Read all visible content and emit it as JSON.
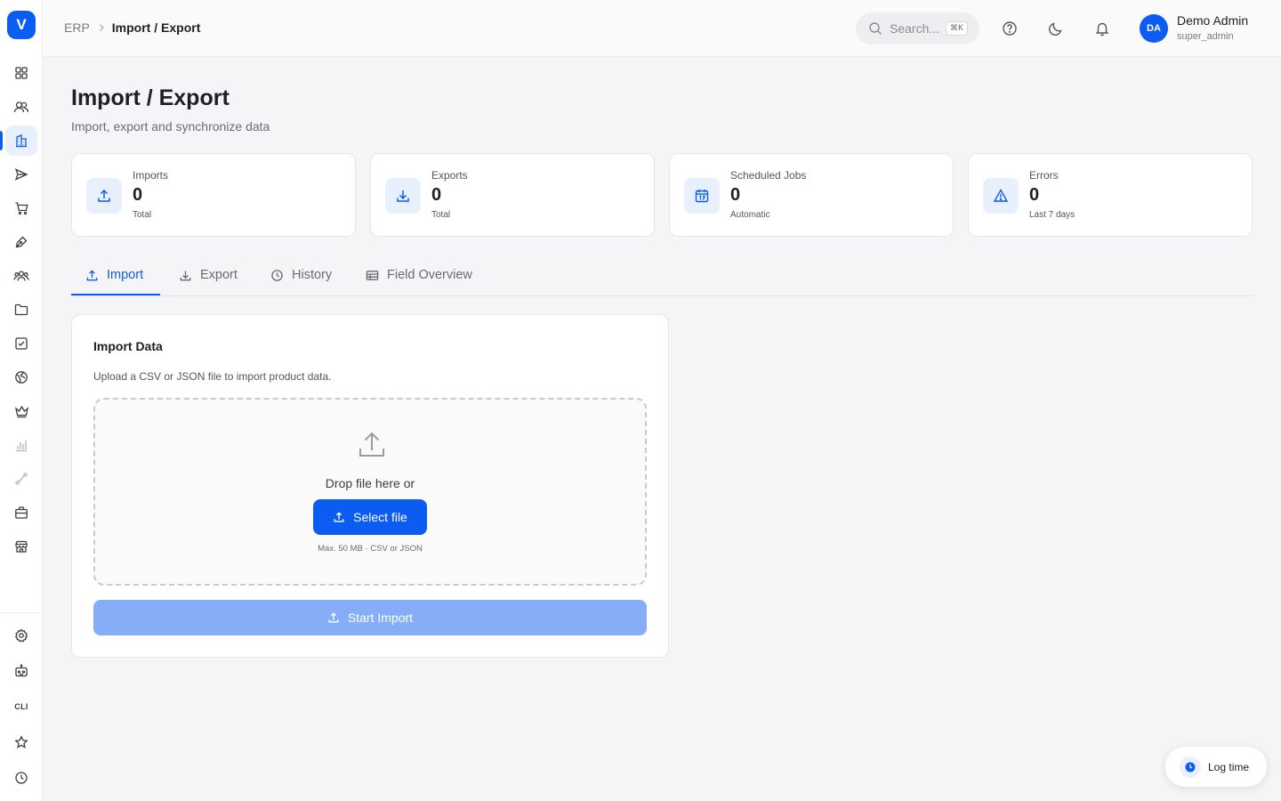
{
  "app": {
    "logo_letter": "V"
  },
  "sidebar": {
    "items": [
      {
        "name": "dashboard-icon"
      },
      {
        "name": "contacts-icon"
      },
      {
        "name": "buildings-icon",
        "active": true
      },
      {
        "name": "send-icon"
      },
      {
        "name": "cart-icon"
      },
      {
        "name": "pen-tool-icon"
      },
      {
        "name": "team-icon"
      },
      {
        "name": "folder-icon"
      },
      {
        "name": "checkbox-icon"
      },
      {
        "name": "globe-icon"
      },
      {
        "name": "crown-icon"
      },
      {
        "name": "bar-chart-icon",
        "muted": true
      },
      {
        "name": "route-icon",
        "muted": true
      },
      {
        "name": "briefcase-icon"
      },
      {
        "name": "store-icon"
      }
    ],
    "bottom_items": [
      {
        "name": "settings-icon"
      },
      {
        "name": "robot-icon"
      },
      {
        "name": "cli-item",
        "label": "CLI"
      },
      {
        "name": "star-icon"
      },
      {
        "name": "clock-icon"
      }
    ]
  },
  "header": {
    "breadcrumb": {
      "root": "ERP",
      "current": "Import / Export"
    },
    "search": {
      "placeholder": "Search...",
      "shortcut": "⌘K"
    },
    "user": {
      "initials": "DA",
      "name": "Demo Admin",
      "role": "super_admin"
    }
  },
  "page": {
    "title": "Import / Export",
    "subtitle": "Import, export and synchronize data"
  },
  "stats": [
    {
      "label": "Imports",
      "value": "0",
      "sub": "Total",
      "icon": "upload-icon"
    },
    {
      "label": "Exports",
      "value": "0",
      "sub": "Total",
      "icon": "download-icon"
    },
    {
      "label": "Scheduled Jobs",
      "value": "0",
      "sub": "Automatic",
      "icon": "calendar-icon"
    },
    {
      "label": "Errors",
      "value": "0",
      "sub": "Last 7 days",
      "icon": "warning-icon"
    }
  ],
  "tabs": [
    {
      "label": "Import",
      "icon": "upload-icon",
      "active": true
    },
    {
      "label": "Export",
      "icon": "download-icon"
    },
    {
      "label": "History",
      "icon": "clock-icon"
    },
    {
      "label": "Field Overview",
      "icon": "table-icon"
    }
  ],
  "import_panel": {
    "title": "Import Data",
    "description": "Upload a CSV or JSON file to import product data.",
    "drop_text": "Drop file here or",
    "select_button": "Select file",
    "hint": "Max. 50 MB · CSV or JSON",
    "start_button": "Start Import"
  },
  "log_time": {
    "label": "Log time"
  },
  "colors": {
    "accent": "#0b5cf0",
    "accent_soft": "#e8effd",
    "disabled_button": "#86aef7",
    "background": "#f5f5f7"
  }
}
